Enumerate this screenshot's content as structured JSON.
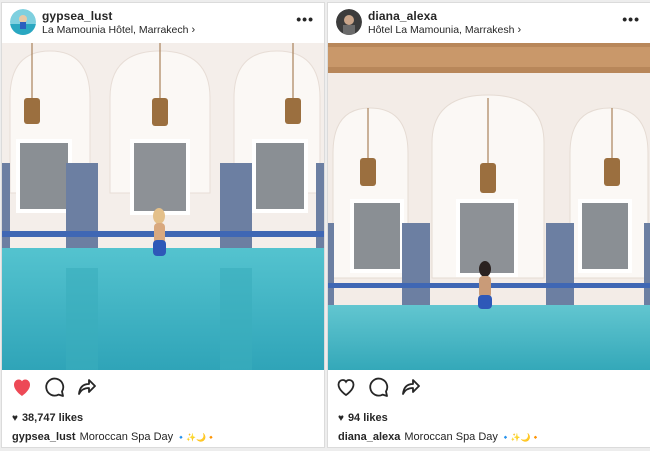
{
  "posts": [
    {
      "username": "gypsea_lust",
      "location": "La Mamounia Hôtel, Marrakech",
      "more_label": "•••",
      "liked": true,
      "likes_text": "38,747 likes",
      "caption_user": "gypsea_lust",
      "caption_text": "Moroccan Spa Day",
      "caption_emoji": "🔹✨🌙🔸",
      "icons": [
        "heart-filled-icon",
        "comment-icon",
        "share-icon"
      ],
      "colors": {
        "like": "#ed4956",
        "pool": "#3fb4c6"
      }
    },
    {
      "username": "diana_alexa",
      "location": "Hôtel La Mamounia, Marrakesh",
      "more_label": "•••",
      "liked": false,
      "likes_text": "94 likes",
      "caption_user": "diana_alexa",
      "caption_text": "Moroccan Spa Day",
      "caption_emoji": "🔹✨🌙🔸",
      "icons": [
        "heart-outline-icon",
        "comment-icon",
        "share-icon"
      ],
      "colors": {
        "like": "#262626",
        "pool": "#45b7c6"
      }
    }
  ]
}
